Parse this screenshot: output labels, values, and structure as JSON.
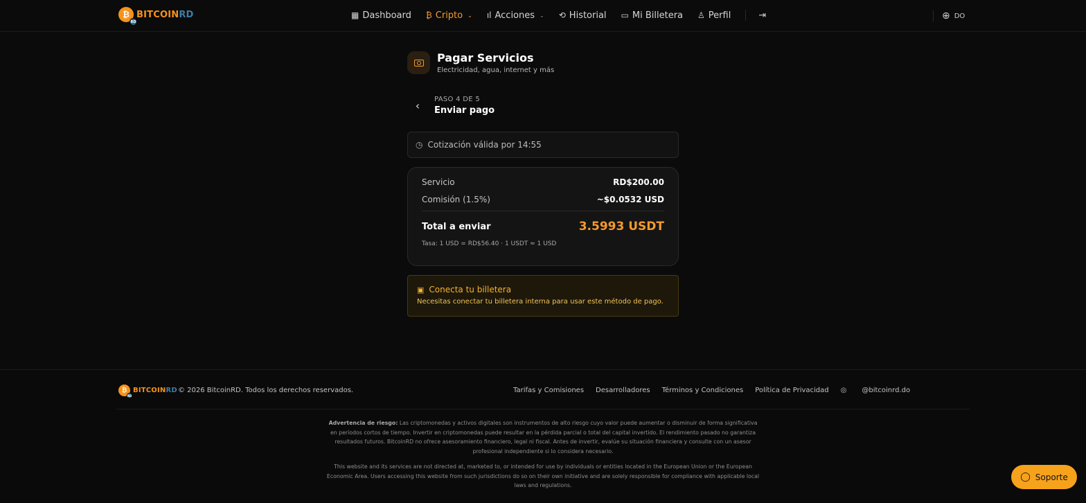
{
  "brand": {
    "coin_symbol": "₿",
    "badge": "RD",
    "name_part1": "BITCOIN",
    "name_part2": "RD"
  },
  "nav": {
    "items": [
      {
        "label": "Dashboard",
        "icon": "▦"
      },
      {
        "label": "Cripto",
        "icon": "₿",
        "chevron": "⌄"
      },
      {
        "label": "Acciones",
        "icon": "ıl",
        "chevron": "⌄"
      },
      {
        "label": "Historial",
        "icon": "⟲"
      },
      {
        "label": "Mi Billetera",
        "icon": "▭"
      },
      {
        "label": "Perfil",
        "icon": "♙"
      }
    ],
    "logout_icon": "⇥",
    "lang_icon": "⊕",
    "lang_code": "DO"
  },
  "page": {
    "title": "Pagar Servicios",
    "subtitle": "Electricidad, agua, internet y más"
  },
  "step": {
    "back_icon": "‹",
    "label": "PASO 4 DE 5",
    "title": "Enviar pago"
  },
  "quote": {
    "icon": "◷",
    "text": "Cotización válida por 14:55"
  },
  "summary": {
    "service_label": "Servicio",
    "service_value": "RD$200.00",
    "fee_label": "Comisión (1.5%)",
    "fee_value": "~$0.0532 USD",
    "total_label": "Total a enviar",
    "total_value": "3.5993 USDT",
    "rate": "Tasa: 1 USD = RD$56.40 · 1 USDT ≈ 1 USD"
  },
  "wallet": {
    "icon": "▣",
    "title": "Conecta tu billetera",
    "message": "Necesitas conectar tu billetera interna para usar este método de pago."
  },
  "footer": {
    "copyright": "© 2026 BitcoinRD. Todos los derechos reservados.",
    "links": [
      "Tarifas y Comisiones",
      "Desarrolladores",
      "Términos y Condiciones",
      "Política de Privacidad"
    ],
    "instagram_icon": "◎",
    "instagram": "@bitcoinrd.do",
    "risk_title": "Advertencia de riesgo:",
    "risk_text": "Las criptomonedas y activos digitales son instrumentos de alto riesgo cuyo valor puede aumentar o disminuir de forma significativa en períodos cortos de tiempo. Invertir en criptomonedas puede resultar en la pérdida parcial o total del capital invertido. El rendimiento pasado no garantiza resultados futuros. BitcoinRD no ofrece asesoramiento financiero, legal ni fiscal. Antes de invertir, evalúe su situación financiera y consulte con un asesor profesional independiente si lo considera necesario.",
    "eu_text": "This website and its services are not directed at, marketed to, or intended for use by individuals or entities located in the European Union or the European Economic Area. Users accessing this website from such jurisdictions do so on their own initiative and are solely responsible for compliance with applicable local laws and regulations."
  },
  "support": {
    "icon": "◯",
    "label": "Soporte"
  },
  "colors": {
    "accent": "#f59a2e",
    "background": "#0b0b0b",
    "warning_bg": "#1e180a"
  }
}
